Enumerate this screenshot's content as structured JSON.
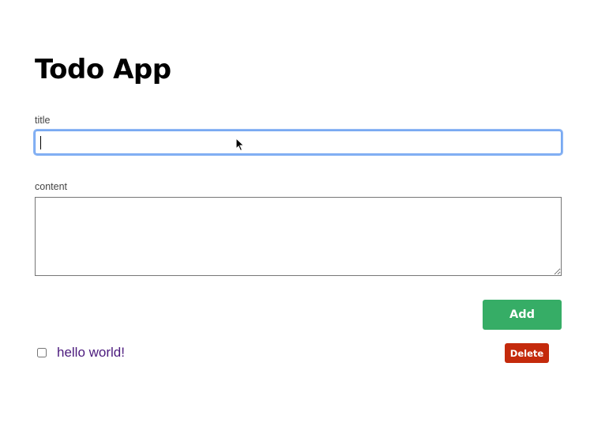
{
  "app": {
    "title": "Todo App"
  },
  "form": {
    "title_label": "title",
    "title_value": "",
    "content_label": "content",
    "content_value": "",
    "add_label": "Add"
  },
  "todos": [
    {
      "title": "hello world!",
      "done": false,
      "delete_label": "Delete"
    }
  ],
  "colors": {
    "add_button": "#36ad66",
    "delete_button": "#c42a0c",
    "todo_text": "#4b1a7d",
    "focus_ring": "#8ab4f4"
  },
  "icons": {
    "pointer": "mouse-pointer-icon"
  }
}
